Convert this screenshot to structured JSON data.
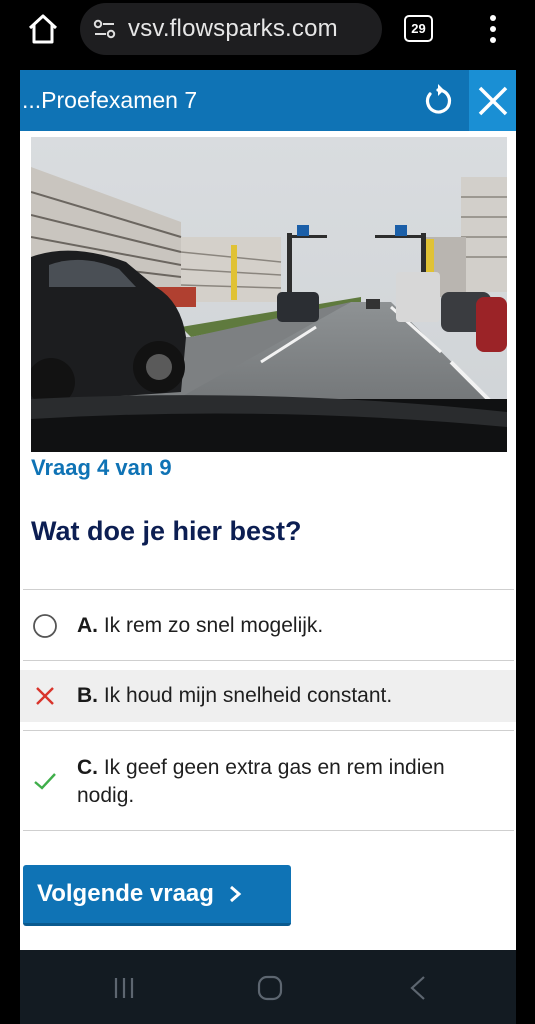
{
  "browser": {
    "url": "vsv.flowsparks.com",
    "tab_count": "29"
  },
  "header": {
    "title": "...Proefexamen 7"
  },
  "question": {
    "counter": "Vraag 4 van 9",
    "text": "Wat doe je hier best?"
  },
  "answers": [
    {
      "letter": "A.",
      "text": "Ik rem zo snel mogelijk.",
      "state": "unselected",
      "icon": "radio-icon"
    },
    {
      "letter": "B.",
      "text": "Ik houd mijn snelheid constant.",
      "state": "wrong",
      "icon": "cross-icon"
    },
    {
      "letter": "C.",
      "text_line1": "Ik geef geen extra gas en rem indien",
      "text_line2": "nodig.",
      "state": "correct",
      "icon": "check-icon"
    }
  ],
  "next_button": {
    "label": "Volgende vraag"
  },
  "colors": {
    "primary": "#0f73b5",
    "close_bg": "#1a8fd4",
    "question_text": "#0c1e52",
    "wrong": "#d9342b",
    "correct": "#3fae4a"
  }
}
